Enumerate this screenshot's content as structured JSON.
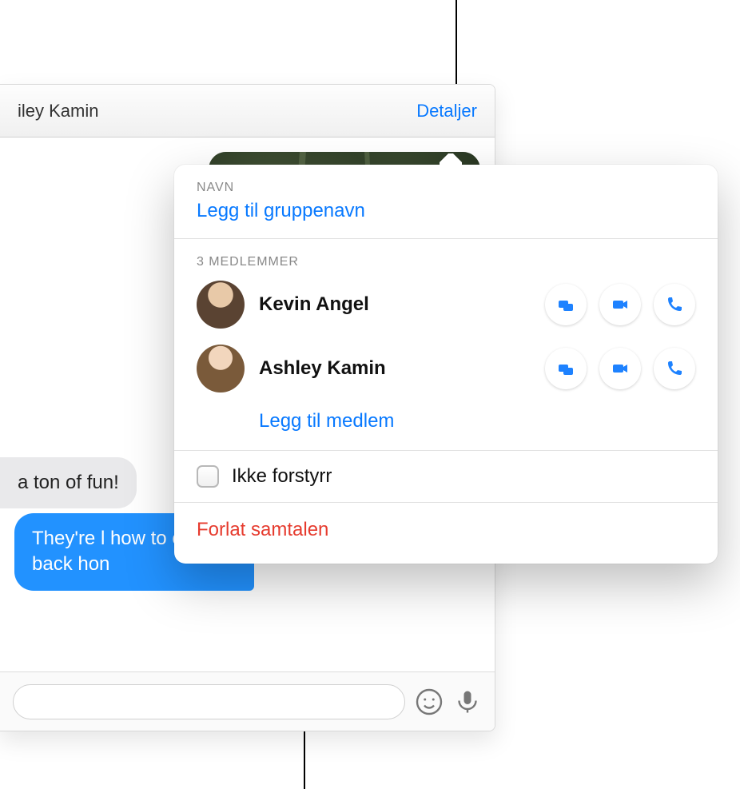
{
  "header": {
    "conversation_title_visible": "iley Kamin",
    "details_button_label": "Detaljer"
  },
  "messages": {
    "incoming_visible_text": "a ton of fun!",
    "outgoing_visible_text": "They're l\nhow to co\nback hon"
  },
  "popover": {
    "name_section_label": "NAVN",
    "add_group_name_link": "Legg til gruppenavn",
    "members_section_label": "3 MEDLEMMER",
    "members": [
      {
        "name": "Kevin Angel"
      },
      {
        "name": "Ashley Kamin"
      }
    ],
    "add_member_link": "Legg til medlem",
    "do_not_disturb_label": "Ikke forstyrr",
    "leave_conversation_label": "Forlat samtalen"
  },
  "colors": {
    "accent": "#0879ff",
    "danger": "#e63b2e",
    "message_blue": "#2292ff",
    "message_grey": "#e9e9eb"
  }
}
